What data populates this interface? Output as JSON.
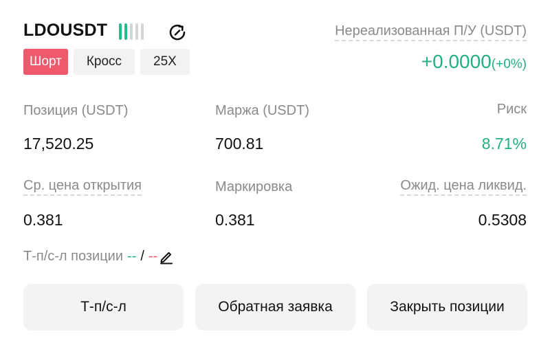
{
  "header": {
    "symbol": "LDOUSDT",
    "share_icon": "share-refresh-icon",
    "tags": {
      "side": "Шорт",
      "margin_mode": "Кросс",
      "leverage": "25X"
    }
  },
  "pnl": {
    "label": "Нереализованная П/У (USDT)",
    "value": "+0.0000",
    "percent": "(+0%)"
  },
  "stats": {
    "position_label": "Позиция (USDT)",
    "position_value": "17,520.25",
    "margin_label": "Маржа (USDT)",
    "margin_value": "700.81",
    "risk_label": "Риск",
    "risk_value": "8.71%",
    "entry_label": "Ср. цена открытия",
    "entry_value": "0.381",
    "mark_label": "Маркировка",
    "mark_value": "0.381",
    "liq_label": "Ожид. цена ликвид.",
    "liq_value": "0.5308"
  },
  "tpsl": {
    "label": "Т-п/с-л позиции",
    "tp": "--",
    "separator": "/",
    "sl": "--",
    "edit_icon": "pencil-icon"
  },
  "buttons": {
    "tpsl": "Т-п/с-л",
    "reverse": "Обратная заявка",
    "close": "Закрыть позиции"
  },
  "colors": {
    "profit": "#21b07f",
    "short": "#f0596c",
    "muted": "#8a8a8a",
    "button_bg": "#f3f3f3"
  }
}
